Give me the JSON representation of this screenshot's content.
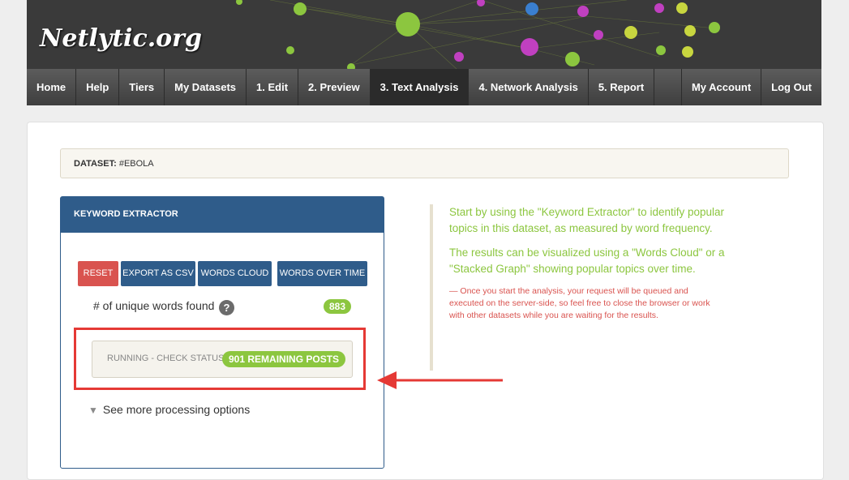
{
  "brand": {
    "logo_text": "Netlytic.org"
  },
  "nav": {
    "left": [
      "Home",
      "Help",
      "Tiers",
      "My Datasets",
      "1. Edit",
      "2. Preview",
      "3. Text Analysis",
      "4. Network Analysis",
      "5. Report"
    ],
    "active_index": 6,
    "right": [
      "My Account",
      "Log Out"
    ]
  },
  "dataset": {
    "label": "DATASET:",
    "value": "#EBOLA"
  },
  "keyword_extractor": {
    "title": "KEYWORD EXTRACTOR",
    "buttons": {
      "reset": "RESET",
      "export": "EXPORT AS CSV",
      "cloud": "WORDS CLOUD",
      "over_time": "WORDS OVER TIME"
    },
    "unique_label": "# of unique words found",
    "unique_count": "883",
    "status_label": "RUNNING - CHECK STATUS",
    "status_badge": "901 REMAINING POSTS",
    "more_options": "See more processing options"
  },
  "info": {
    "p1": "Start by using the \"Keyword Extractor\" to identify popular topics in this dataset, as measured by word frequency.",
    "p2": "The results can be visualized using a \"Words Cloud\" or a \"Stacked Graph\" showing popular topics over time.",
    "note": "— Once you start the analysis, your request will be queued and executed on the server-side, so feel free to close the browser or work with other datasets while you are waiting for the results."
  },
  "colors": {
    "accent_blue": "#2f5c8a",
    "green": "#8cc63f",
    "red": "#d9534f",
    "highlight": "#e53935"
  },
  "icons": {
    "help": "question-icon",
    "more": "arrow-down-icon"
  }
}
